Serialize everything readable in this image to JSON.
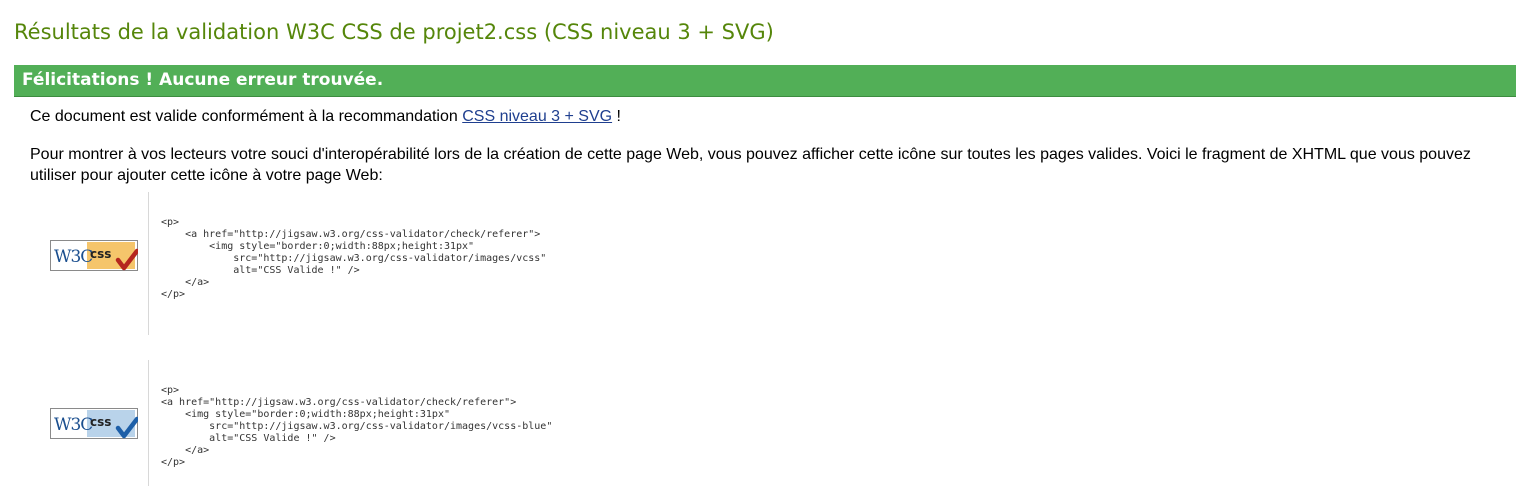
{
  "header": {
    "title": "Résultats de la validation W3C CSS de projet2.css (CSS niveau 3 + SVG)"
  },
  "banner": {
    "text": "Félicitations ! Aucune erreur trouvée."
  },
  "intro": {
    "before": "Ce document est valide conformément à la recommandation ",
    "link": "CSS niveau 3 + SVG",
    "after": " !"
  },
  "explanation": "Pour montrer à vos lecteurs votre souci d'interopérabilité lors de la création de cette page Web, vous pouvez afficher cette icône sur toutes les pages valides. Voici le fragment de XHTML que vous pouvez utiliser pour ajouter cette icône à votre page Web:",
  "badges": [
    {
      "w3c_text": "W3C",
      "css_text": "css",
      "panel_color": "#f5c56b",
      "check_color": "#b5261e",
      "snippet": "<p>\n    <a href=\"http://jigsaw.w3.org/css-validator/check/referer\">\n        <img style=\"border:0;width:88px;height:31px\"\n            src=\"http://jigsaw.w3.org/css-validator/images/vcss\"\n            alt=\"CSS Valide !\" />\n    </a>\n</p>"
    },
    {
      "w3c_text": "W3C",
      "css_text": "css",
      "panel_color": "#b9d3ea",
      "check_color": "#1d5fa8",
      "snippet": "<p>\n<a href=\"http://jigsaw.w3.org/css-validator/check/referer\">\n    <img style=\"border:0;width:88px;height:31px\"\n        src=\"http://jigsaw.w3.org/css-validator/images/vcss-blue\"\n        alt=\"CSS Valide !\" />\n    </a>\n</p>"
    }
  ]
}
